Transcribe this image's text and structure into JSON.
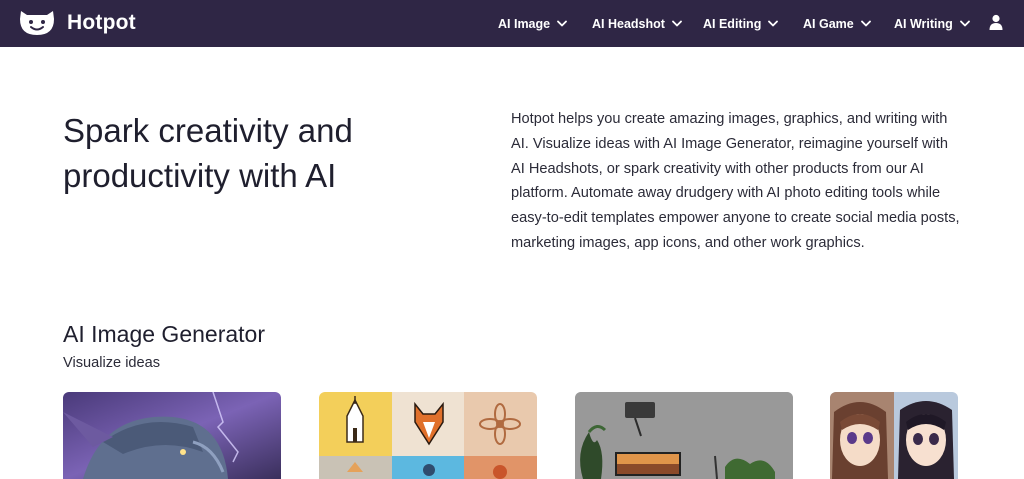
{
  "brand": {
    "name": "Hotpot",
    "logo_icon": "hotpot-face-logo"
  },
  "nav": {
    "items": [
      {
        "label": "AI Image",
        "icon": "chevron-down-icon"
      },
      {
        "label": "AI Headshot",
        "icon": "chevron-down-icon"
      },
      {
        "label": "AI Editing",
        "icon": "chevron-down-icon"
      },
      {
        "label": "AI Game",
        "icon": "chevron-down-icon"
      },
      {
        "label": "AI Writing",
        "icon": "chevron-down-icon"
      }
    ],
    "account_icon": "user-icon"
  },
  "hero": {
    "title": "Spark creativity and productivity with AI",
    "description": "Hotpot helps you create amazing images, graphics, and writing with AI. Visualize ideas with AI Image Generator, reimagine yourself with AI Headshots, or spark creativity with other products from our AI platform. Automate away drudgery with AI photo editing tools while easy-to-edit templates empower anyone to create social media posts, marketing images, app icons, and other work graphics."
  },
  "section": {
    "title": "AI Image Generator",
    "subtitle": "Visualize ideas",
    "cards": [
      {
        "image": "fantasy-elf-portrait"
      },
      {
        "image": "icon-grid-samples"
      },
      {
        "image": "desk-workspace-photo"
      },
      {
        "image": "anime-girls-portrait"
      }
    ]
  },
  "colors": {
    "nav_bg": "#2f2645",
    "text": "#1f1f2e",
    "nav_text": "#ffffff"
  }
}
